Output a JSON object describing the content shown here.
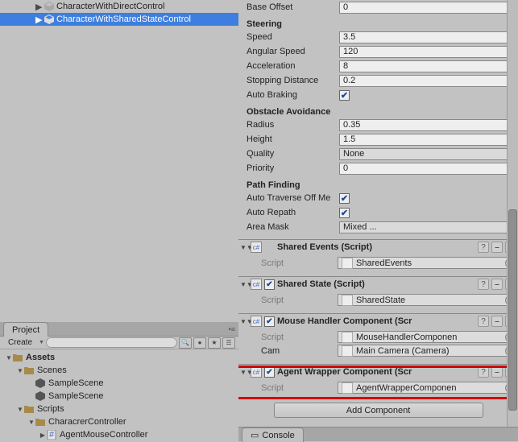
{
  "hierarchy": {
    "item_dim": "CharacterWithDirectControl",
    "item_sel": "CharacterWithSharedStateControl"
  },
  "project": {
    "tab": "Project",
    "create": "Create",
    "root": "Assets",
    "scenes": "Scenes",
    "sample1": "SampleScene",
    "sample2": "SampleScene",
    "scripts": "Scripts",
    "char_ctrl": "CharacrerController",
    "agent_mouse": "AgentMouseController"
  },
  "nav": {
    "base_offset": {
      "label": "Base Offset",
      "value": "0"
    },
    "steering_hdr": "Steering",
    "speed": {
      "label": "Speed",
      "value": "3.5"
    },
    "ang_speed": {
      "label": "Angular Speed",
      "value": "120"
    },
    "accel": {
      "label": "Acceleration",
      "value": "8"
    },
    "stop_dist": {
      "label": "Stopping Distance",
      "value": "0.2"
    },
    "auto_brake": "Auto Braking",
    "obstacle_hdr": "Obstacle Avoidance",
    "radius": {
      "label": "Radius",
      "value": "0.35"
    },
    "height": {
      "label": "Height",
      "value": "1.5"
    },
    "quality": {
      "label": "Quality",
      "value": "None"
    },
    "priority": {
      "label": "Priority",
      "value": "0"
    },
    "path_hdr": "Path Finding",
    "auto_traverse": "Auto Traverse Off Me",
    "auto_repath": "Auto Repath",
    "area_mask": {
      "label": "Area Mask",
      "value": "Mixed ..."
    }
  },
  "comps": {
    "script_label": "Script",
    "shared_events": {
      "title": "Shared Events (Script)",
      "script": "SharedEvents"
    },
    "shared_state": {
      "title": "Shared State (Script)",
      "script": "SharedState"
    },
    "mouse_handler": {
      "title": "Mouse Handler Component (Scr",
      "script": "MouseHandlerComponen",
      "cam_label": "Cam",
      "cam_value": "Main Camera (Camera)"
    },
    "agent_wrapper": {
      "title": "Agent Wrapper Component (Scr",
      "script": "AgentWrapperComponen"
    }
  },
  "add_component": "Add Component",
  "console": "Console"
}
